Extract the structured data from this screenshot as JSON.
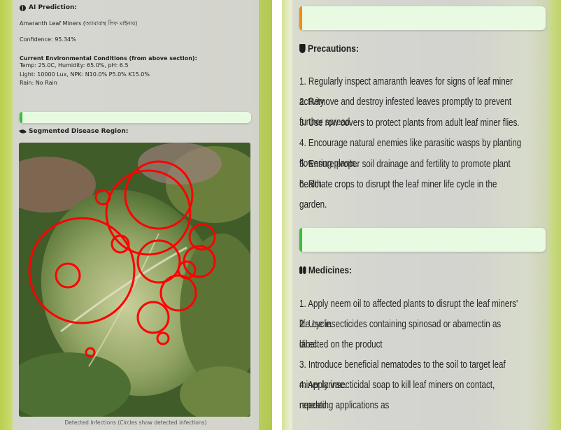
{
  "prediction": {
    "heading": "AI Prediction:",
    "label": "Amaranth Leaf Miners (অ্যামারান্থ লিফ মাইনার)",
    "confidence": "Confidence: 95.34%"
  },
  "environment": {
    "heading": "Current Environmental Conditions (from above section):",
    "lines": [
      "Temp: 25.0C, Humidity: 65.0%, pH: 6.5",
      "Light: 10000 Lux, NPK: N10.0% P5.0% K15.0%",
      "Rain: No Rain"
    ]
  },
  "segmentation": {
    "heading": "Segmented Disease Region:",
    "caption": "Detected Infections (Circles show detected infections)"
  },
  "precautions": {
    "heading": "Precautions:",
    "items": [
      "1. Regularly inspect amaranth leaves for signs of leaf miner activity.",
      "2. Remove and destroy infested leaves promptly to prevent further spread.",
      "3. Use row covers to protect plants from adult leaf miner flies.",
      "4. Encourage natural enemies like parasitic wasps by planting flowering plants.",
      "5. Ensure proper soil drainage and fertility to promote plant health.",
      "6. Rotate crops to disrupt the leaf miner life cycle in the garden."
    ]
  },
  "medicines": {
    "heading": "Medicines:",
    "items": [
      "1. Apply neem oil to affected plants to disrupt the leaf miners' life cycle.",
      "2. Use insecticides containing spinosad or abamectin as directed on the product",
      "label.",
      "3. Introduce beneficial nematodes to the soil to target leaf miner larvae.",
      "4. Apply insecticidal soap to kill leaf miners on contact, repeating applications as",
      "needed."
    ]
  },
  "colors": {
    "accent_green": "#3dbb3d",
    "accent_orange": "#f08c16",
    "bar_fill": "#e8fbe2",
    "detection_circle": "#ff0000"
  },
  "icons": {
    "prediction": "brain-icon",
    "segmentation": "leaf-icon",
    "precautions": "shield-icon",
    "medicines": "pills-icon"
  }
}
